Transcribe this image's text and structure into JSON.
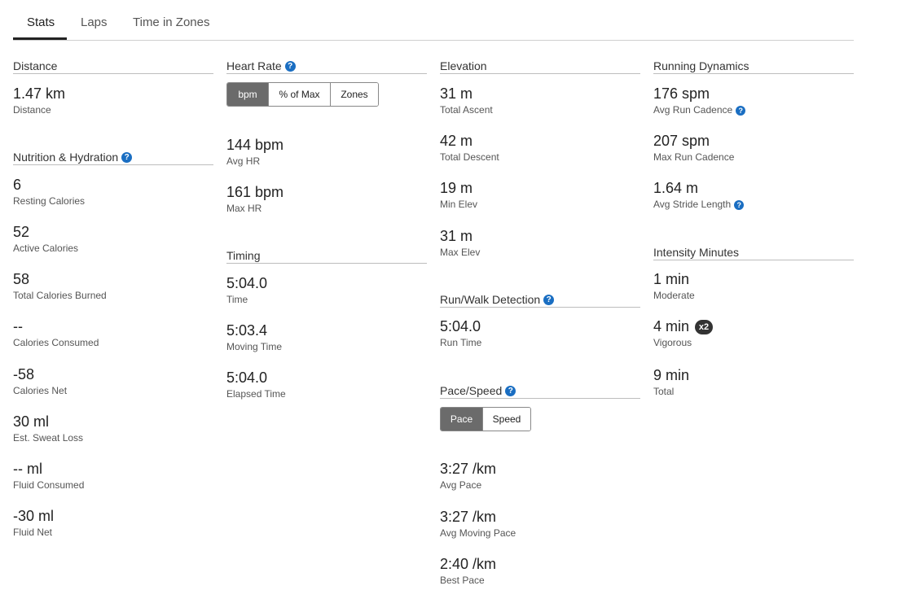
{
  "tabs": [
    "Stats",
    "Laps",
    "Time in Zones"
  ],
  "distance": {
    "header": "Distance",
    "stats": [
      {
        "value": "1.47 km",
        "label": "Distance"
      }
    ]
  },
  "nutrition": {
    "header": "Nutrition & Hydration",
    "stats": [
      {
        "value": "6",
        "label": "Resting Calories"
      },
      {
        "value": "52",
        "label": "Active Calories"
      },
      {
        "value": "58",
        "label": "Total Calories Burned"
      },
      {
        "value": "--",
        "label": "Calories Consumed"
      },
      {
        "value": "-58",
        "label": "Calories Net"
      },
      {
        "value": "30 ml",
        "label": "Est. Sweat Loss"
      },
      {
        "value": "-- ml",
        "label": "Fluid Consumed"
      },
      {
        "value": "-30 ml",
        "label": "Fluid Net"
      }
    ]
  },
  "heart_rate": {
    "header": "Heart Rate",
    "toggle": [
      "bpm",
      "% of Max",
      "Zones"
    ],
    "selected": "bpm",
    "stats": [
      {
        "value": "144 bpm",
        "label": "Avg HR"
      },
      {
        "value": "161 bpm",
        "label": "Max HR"
      }
    ]
  },
  "timing": {
    "header": "Timing",
    "stats": [
      {
        "value": "5:04.0",
        "label": "Time"
      },
      {
        "value": "5:03.4",
        "label": "Moving Time"
      },
      {
        "value": "5:04.0",
        "label": "Elapsed Time"
      }
    ]
  },
  "elevation": {
    "header": "Elevation",
    "stats": [
      {
        "value": "31 m",
        "label": "Total Ascent"
      },
      {
        "value": "42 m",
        "label": "Total Descent"
      },
      {
        "value": "19 m",
        "label": "Min Elev"
      },
      {
        "value": "31 m",
        "label": "Max Elev"
      }
    ]
  },
  "run_walk": {
    "header": "Run/Walk Detection",
    "stats": [
      {
        "value": "5:04.0",
        "label": "Run Time"
      }
    ]
  },
  "pace_speed": {
    "header": "Pace/Speed",
    "toggle": [
      "Pace",
      "Speed"
    ],
    "selected": "Pace",
    "stats": [
      {
        "value": "3:27 /km",
        "label": "Avg Pace"
      },
      {
        "value": "3:27 /km",
        "label": "Avg Moving Pace"
      },
      {
        "value": "2:40 /km",
        "label": "Best Pace"
      }
    ]
  },
  "running_dynamics": {
    "header": "Running Dynamics",
    "stats": [
      {
        "value": "176 spm",
        "label": "Avg Run Cadence"
      },
      {
        "value": "207 spm",
        "label": "Max Run Cadence"
      },
      {
        "value": "1.64 m",
        "label": "Avg Stride Length"
      }
    ]
  },
  "intensity": {
    "header": "Intensity Minutes",
    "stats": [
      {
        "value": "1 min",
        "label": "Moderate"
      },
      {
        "value": "4 min",
        "label": "Vigorous",
        "badge": "x2"
      },
      {
        "value": "9 min",
        "label": "Total"
      }
    ]
  },
  "icons": {
    "help": "question-mark-icon",
    "help_glyph": "?"
  },
  "colors": {
    "help_icon": "#1a6ec2",
    "toggle_active": "#6b6b6b",
    "badge": "#333333"
  }
}
